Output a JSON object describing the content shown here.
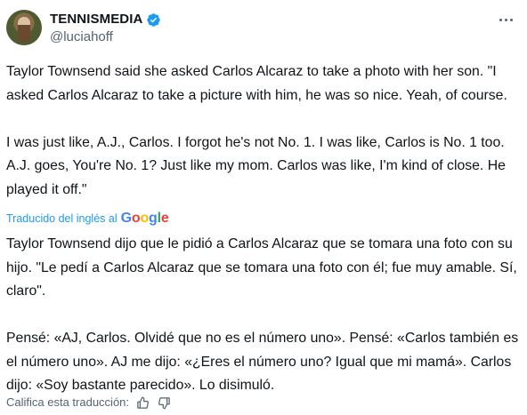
{
  "author": {
    "display_name": "TENNISMEDIA",
    "handle": "@luciahoff",
    "verified": true
  },
  "colors": {
    "text": "#0f1419",
    "secondary": "#536471",
    "link": "#1d9bf0",
    "verified_badge": "#1d9bf0"
  },
  "icons": {
    "verified": "verified-badge-icon",
    "more": "more-options-icon",
    "thumbs_up": "thumbs-up-icon",
    "thumbs_down": "thumbs-down-icon"
  },
  "tweet": {
    "original_text": "Taylor Townsend said she asked Carlos Alcaraz to take a photo with her son. \"I asked Carlos Alcaraz to take a picture with him, he was so nice. Yeah, of course.\n\nI was just like, A.J., Carlos. I forgot he's not No. 1. I was like, Carlos is No. 1 too. A.J. goes, You're No. 1? Just like my mom. Carlos was like, I'm kind of close. He played it off.\"",
    "translated_by_label": "Traducido del inglés al",
    "translation_provider": "Google",
    "translated_text": "Taylor Townsend dijo que le pidió a Carlos Alcaraz que se tomara una foto con su hijo. \"Le pedí a Carlos Alcaraz que se tomara una foto con él; fue muy amable. Sí, claro\".\n\nPensé: «AJ, Carlos. Olvidé que no es el número uno». Pensé: «Carlos también es el número uno». AJ me dijo: «¿Eres el número uno? Igual que mi mamá». Carlos dijo: «Soy bastante parecido». Lo disimuló.",
    "rate_label": "Califica esta traducción:"
  }
}
